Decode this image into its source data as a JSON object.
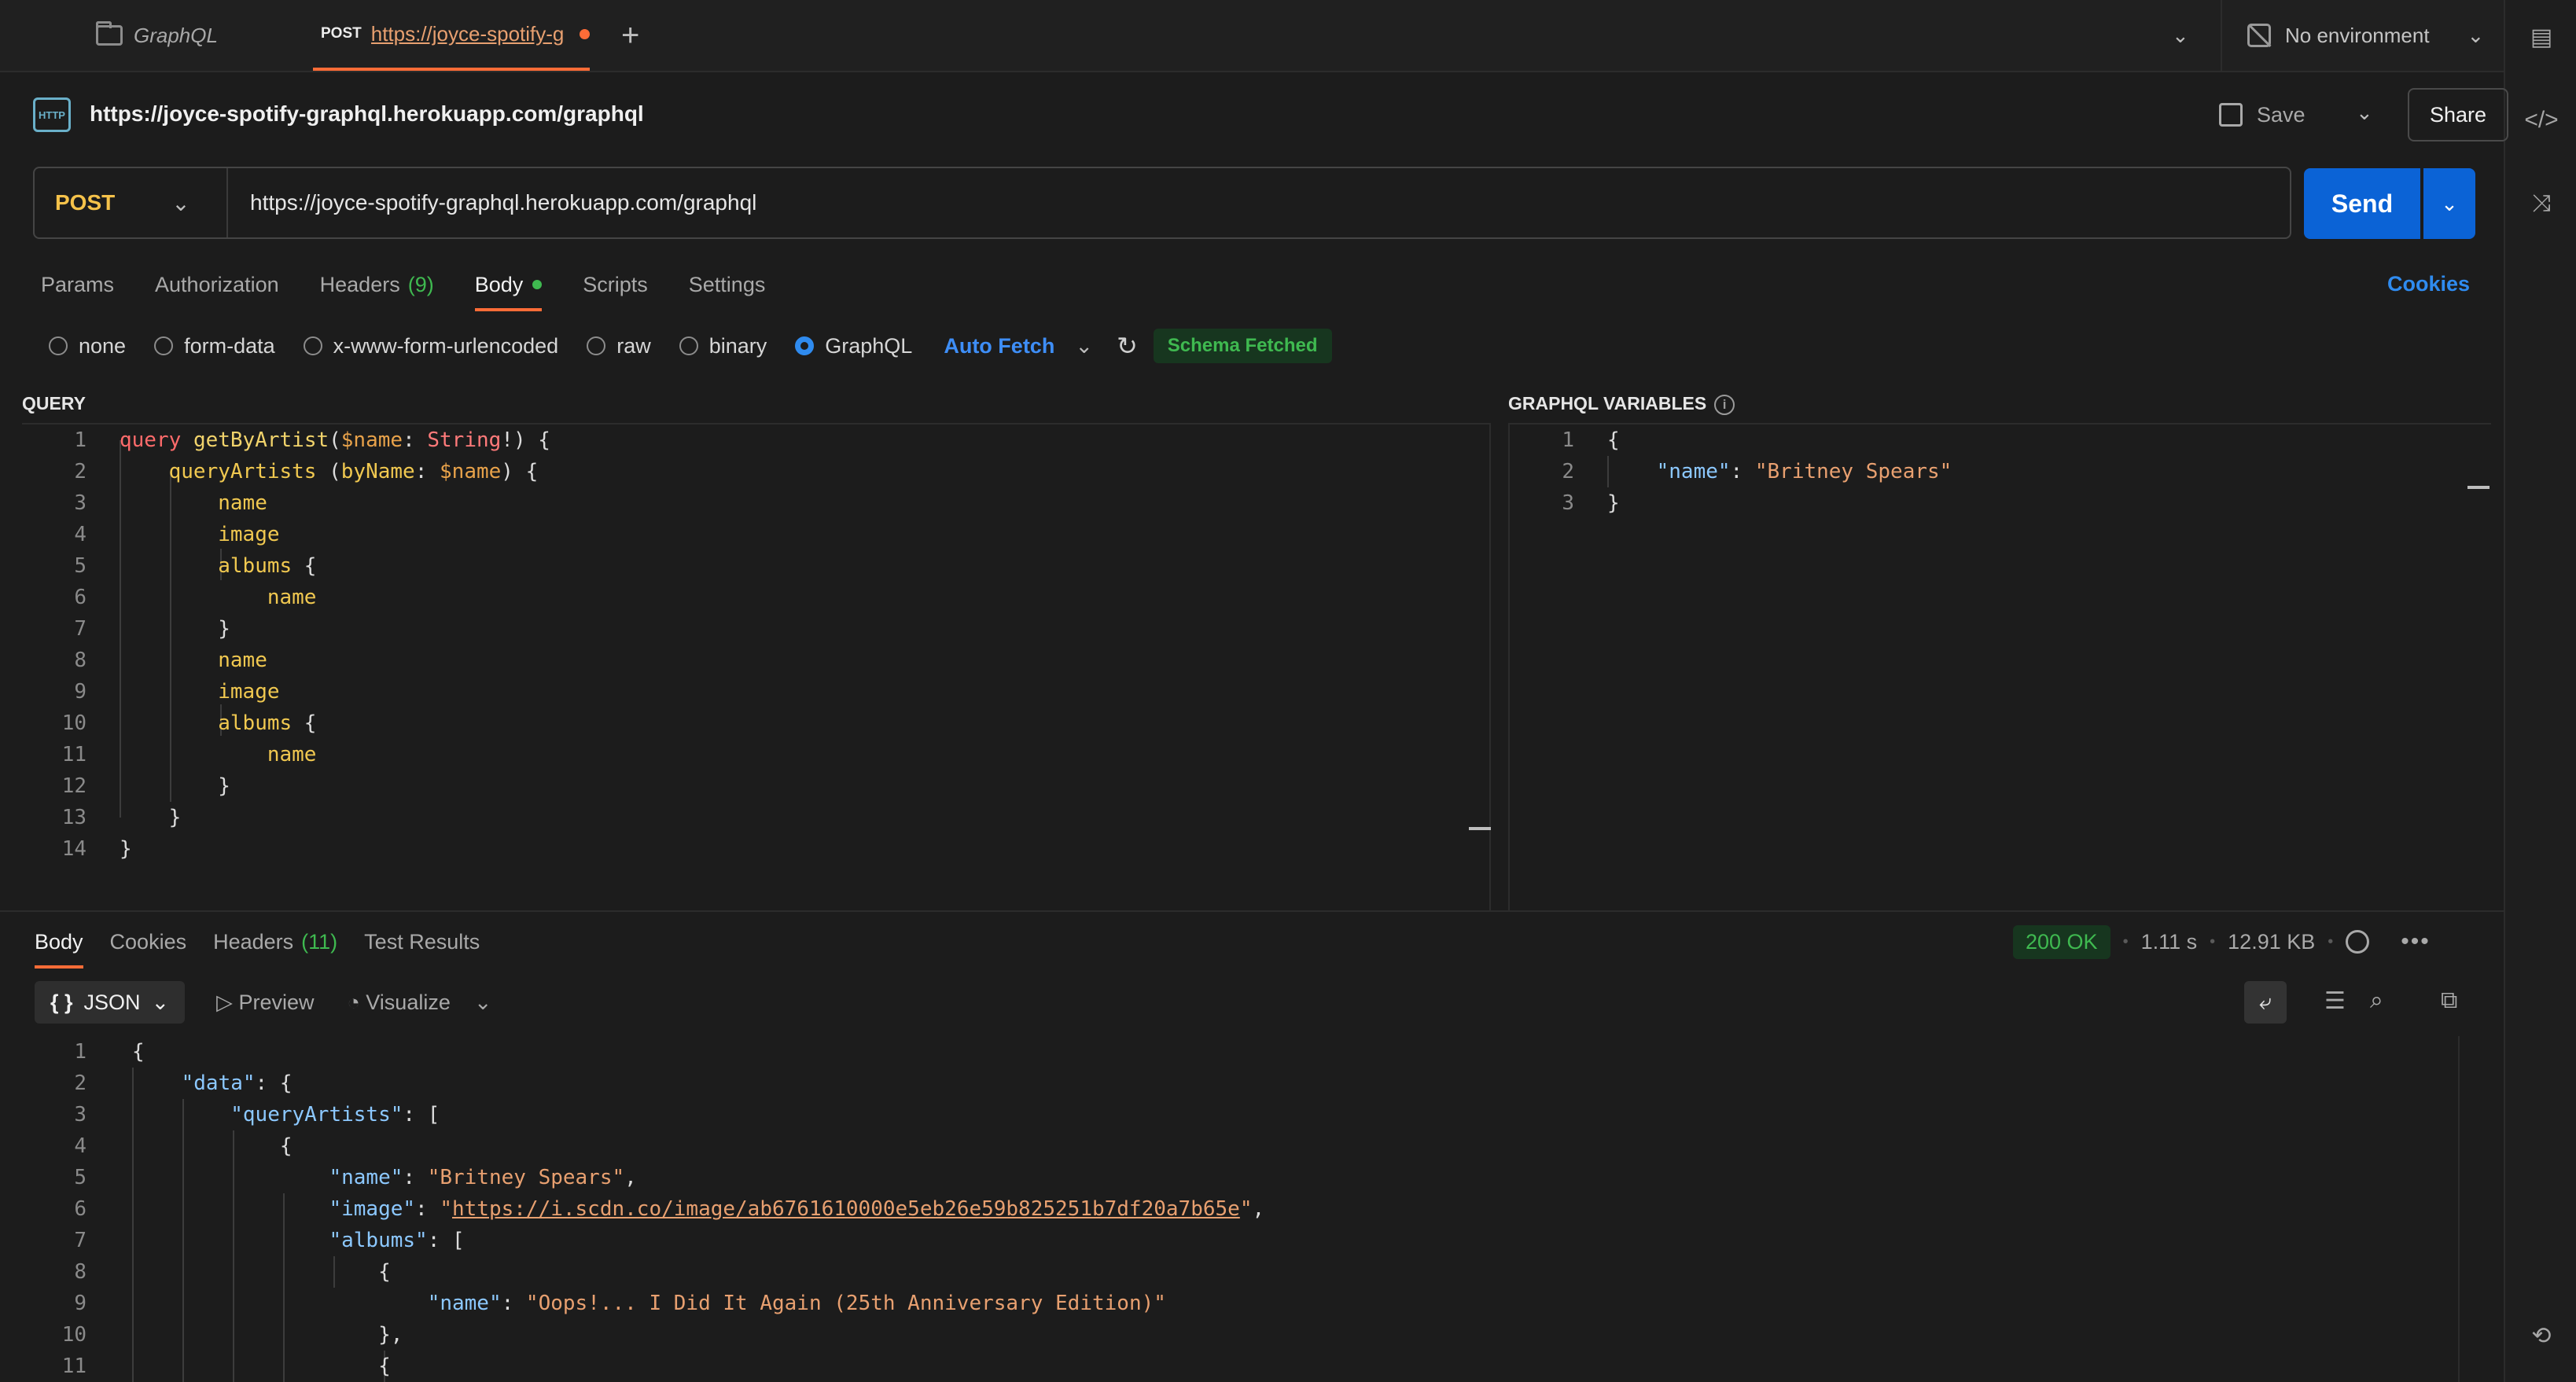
{
  "tabs": {
    "collection_tab": "GraphQL",
    "active_tab": {
      "method": "POST",
      "title": "https://joyce-spotify-g"
    },
    "environment": "No environment"
  },
  "request": {
    "title": "https://joyce-spotify-graphql.herokuapp.com/graphql",
    "save_label": "Save",
    "share_label": "Share",
    "method": "POST",
    "url": "https://joyce-spotify-graphql.herokuapp.com/graphql",
    "send_label": "Send",
    "http_badge": "HTTP"
  },
  "request_tabs": [
    {
      "label": "Params"
    },
    {
      "label": "Authorization"
    },
    {
      "label": "Headers",
      "count": "(9)"
    },
    {
      "label": "Body"
    },
    {
      "label": "Scripts"
    },
    {
      "label": "Settings"
    }
  ],
  "cookies_label": "Cookies",
  "body_types": [
    "none",
    "form-data",
    "x-www-form-urlencoded",
    "raw",
    "binary",
    "GraphQL"
  ],
  "selected_body_type": "GraphQL",
  "auto_fetch": "Auto Fetch",
  "schema_status": "Schema Fetched",
  "query_title": "QUERY",
  "variables_title": "GRAPHQL VARIABLES",
  "query_lines": [
    "1",
    "2",
    "3",
    "4",
    "5",
    "6",
    "7",
    "8",
    "9",
    "10",
    "11",
    "12",
    "13",
    "14"
  ],
  "variables_lines": [
    "1",
    "2",
    "3"
  ],
  "response": {
    "tabs": [
      {
        "label": "Body"
      },
      {
        "label": "Cookies"
      },
      {
        "label": "Headers",
        "count": "(11)"
      },
      {
        "label": "Test Results"
      }
    ],
    "status": "200 OK",
    "time": "1.11 s",
    "size": "12.91 KB",
    "format": "JSON",
    "preview_label": "Preview",
    "visualize_label": "Visualize",
    "line_numbers": [
      "1",
      "2",
      "3",
      "4",
      "5",
      "6",
      "7",
      "8",
      "9",
      "10",
      "11"
    ],
    "artist_name": "Britney Spears",
    "image_url": "https://i.scdn.co/image/ab6761610000e5eb26e59b825251b7df20a7b65e",
    "album_name": "Oops!... I Did It Again (25th Anniversary Edition)"
  },
  "colors": {
    "accent": "#ff6c37",
    "send": "#0b63d6",
    "method_post": "#f5c24a",
    "success": "#3fb950",
    "link": "#2f8bef"
  },
  "icons": [
    "folder-icon",
    "plus-icon",
    "no-environment-icon",
    "http-icon",
    "save-icon",
    "refresh-icon",
    "info-icon",
    "globe-icon",
    "more-icon",
    "wrap-icon",
    "filter-icon",
    "search-icon",
    "copy-icon",
    "code-icon",
    "history-icon"
  ]
}
